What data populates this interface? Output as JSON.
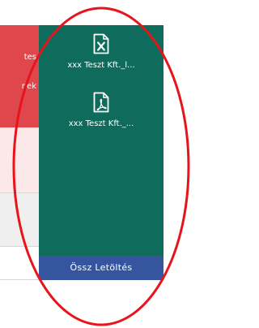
{
  "left_table": {
    "header_fragment_1": "tes",
    "header_fragment_2": "nek"
  },
  "downloads": {
    "files": [
      {
        "name": "xxx Teszt Kft._l...",
        "icon": "excel-file-icon"
      },
      {
        "name": "xxx Teszt Kft._...",
        "icon": "pdf-file-icon"
      }
    ],
    "download_all_label": "Össz Letöltés"
  },
  "colors": {
    "panel_bg": "#0f6b5b",
    "button_bg": "#35569f",
    "header_red": "#e0474c",
    "annotation_red": "#e8141c"
  }
}
